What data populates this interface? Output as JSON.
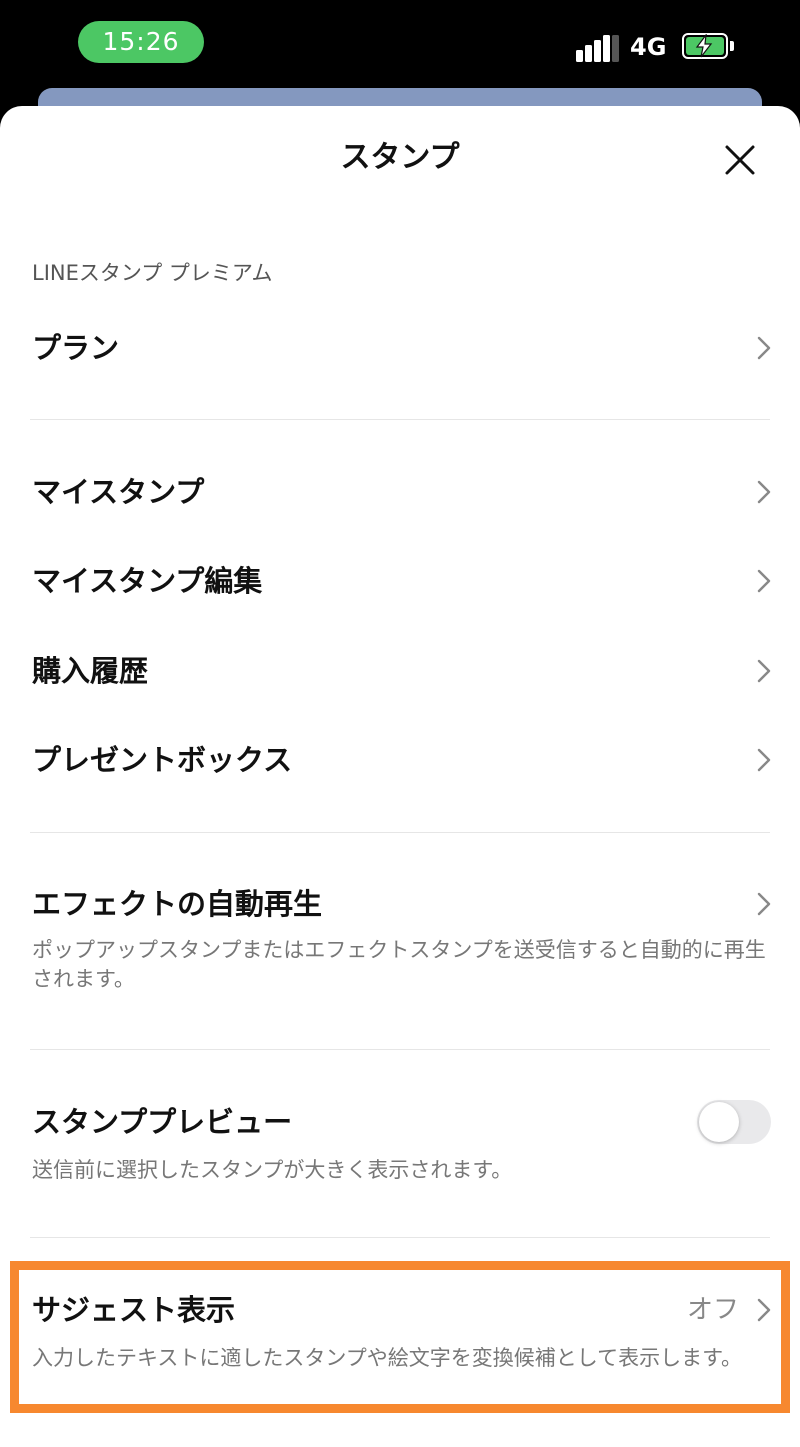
{
  "status_bar": {
    "time": "15:26",
    "network": "4G",
    "time_pill_color": "#4cc764",
    "battery_color": "#4cc764",
    "battery_icon": "battery-charging-icon",
    "signal_icon": "signal-bars-icon"
  },
  "header": {
    "title": "スタンプ",
    "close_icon": "close-icon"
  },
  "section": {
    "premium_label": "LINEスタンプ プレミアム"
  },
  "items": {
    "plan": {
      "label": "プラン"
    },
    "my_stickers": {
      "label": "マイスタンプ"
    },
    "my_stickers_edit": {
      "label": "マイスタンプ編集"
    },
    "purchase_history": {
      "label": "購入履歴"
    },
    "present_box": {
      "label": "プレゼントボックス"
    },
    "effect_autoplay": {
      "label": "エフェクトの自動再生",
      "description": "ポップアップスタンプまたはエフェクトスタンプを送受信すると自動的に再生されます。"
    },
    "sticker_preview": {
      "label": "スタンププレビュー",
      "description": "送信前に選択したスタンプが大きく表示されます。",
      "toggle_on": false
    },
    "suggest": {
      "label": "サジェスト表示",
      "value": "オフ",
      "description": "入力したテキストに適したスタンプや絵文字を変換候補として表示します。"
    }
  },
  "colors": {
    "highlight": "#f7882f",
    "peek_card": "#8498bf"
  }
}
